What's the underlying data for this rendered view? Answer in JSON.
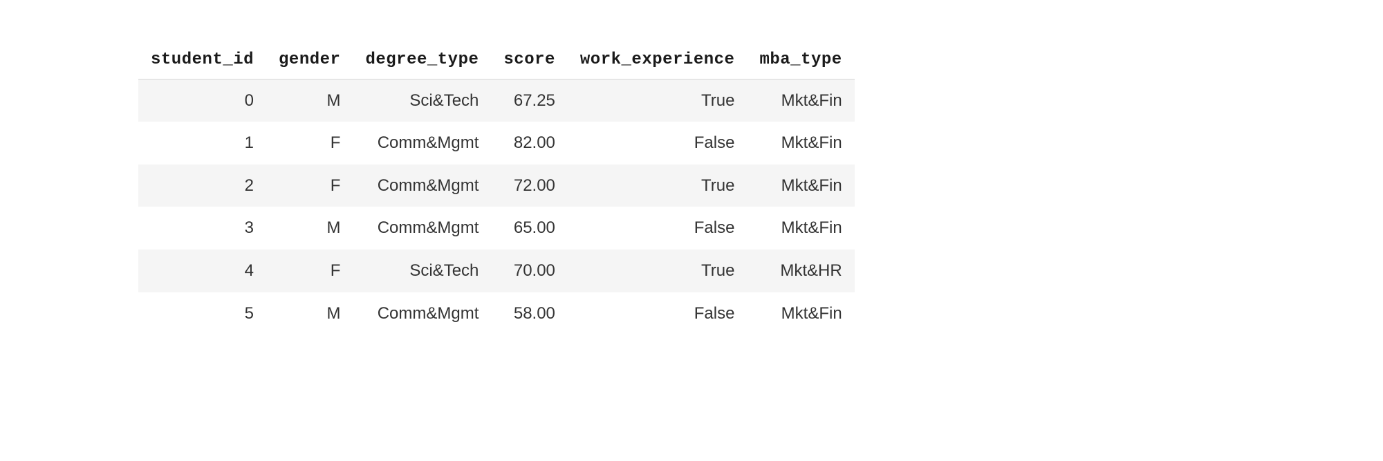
{
  "table": {
    "columns": [
      "student_id",
      "gender",
      "degree_type",
      "score",
      "work_experience",
      "mba_type"
    ],
    "rows": [
      {
        "student_id": "0",
        "gender": "M",
        "degree_type": "Sci&Tech",
        "score": "67.25",
        "work_experience": "True",
        "mba_type": "Mkt&Fin"
      },
      {
        "student_id": "1",
        "gender": "F",
        "degree_type": "Comm&Mgmt",
        "score": "82.00",
        "work_experience": "False",
        "mba_type": "Mkt&Fin"
      },
      {
        "student_id": "2",
        "gender": "F",
        "degree_type": "Comm&Mgmt",
        "score": "72.00",
        "work_experience": "True",
        "mba_type": "Mkt&Fin"
      },
      {
        "student_id": "3",
        "gender": "M",
        "degree_type": "Comm&Mgmt",
        "score": "65.00",
        "work_experience": "False",
        "mba_type": "Mkt&Fin"
      },
      {
        "student_id": "4",
        "gender": "F",
        "degree_type": "Sci&Tech",
        "score": "70.00",
        "work_experience": "True",
        "mba_type": "Mkt&HR"
      },
      {
        "student_id": "5",
        "gender": "M",
        "degree_type": "Comm&Mgmt",
        "score": "58.00",
        "work_experience": "False",
        "mba_type": "Mkt&Fin"
      }
    ]
  }
}
